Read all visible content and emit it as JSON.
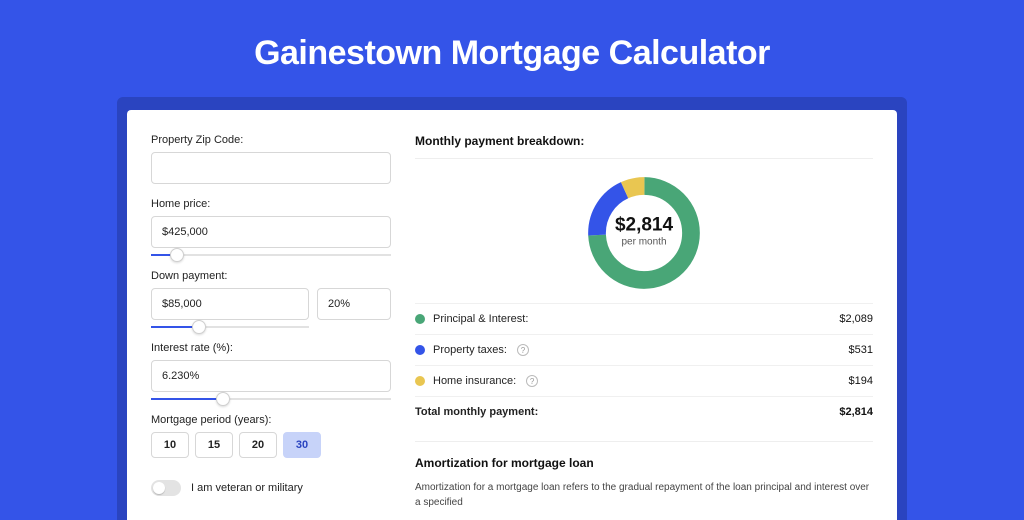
{
  "title": "Gainestown Mortgage Calculator",
  "form": {
    "zip_label": "Property Zip Code:",
    "zip_value": "",
    "home_price_label": "Home price:",
    "home_price_value": "$425,000",
    "down_payment_label": "Down payment:",
    "down_payment_value": "$85,000",
    "down_payment_pct": "20%",
    "interest_label": "Interest rate (%):",
    "interest_value": "6.230%",
    "period_label": "Mortgage period (years):",
    "periods": [
      "10",
      "15",
      "20",
      "30"
    ],
    "period_selected": "30",
    "veteran_label": "I am veteran or military"
  },
  "breakdown": {
    "title": "Monthly payment breakdown:",
    "center_amount": "$2,814",
    "center_sub": "per month",
    "rows": [
      {
        "label": "Principal & Interest:",
        "value": "$2,089",
        "pct": 74.2
      },
      {
        "label": "Property taxes:",
        "value": "$531",
        "pct": 18.9,
        "help": true
      },
      {
        "label": "Home insurance:",
        "value": "$194",
        "pct": 6.9,
        "help": true
      }
    ],
    "total_label": "Total monthly payment:",
    "total_value": "$2,814"
  },
  "amort": {
    "title": "Amortization for mortgage loan",
    "text": "Amortization for a mortgage loan refers to the gradual repayment of the loan principal and interest over a specified"
  },
  "chart_data": {
    "type": "pie",
    "title": "Monthly payment breakdown",
    "series": [
      {
        "name": "Principal & Interest",
        "value": 2089,
        "color": "#49a677"
      },
      {
        "name": "Property taxes",
        "value": 531,
        "color": "#3454e8"
      },
      {
        "name": "Home insurance",
        "value": 194,
        "color": "#e9c651"
      }
    ],
    "total": 2814,
    "center_label": "$2,814 per month"
  }
}
